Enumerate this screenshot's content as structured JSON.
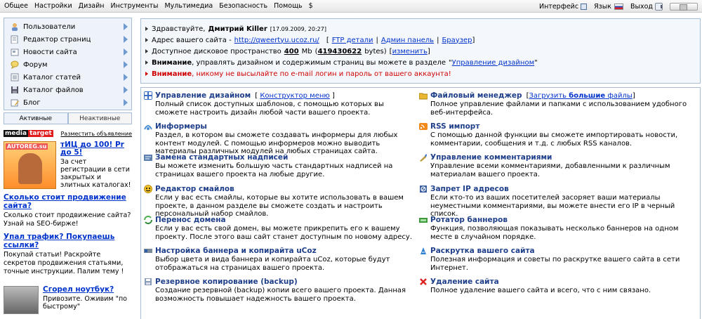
{
  "topbar": {
    "menu": [
      "Общее",
      "Настройки",
      "Дизайн",
      "Инструменты",
      "Мультимедиа",
      "Безопасность",
      "Помощь",
      "$"
    ],
    "interface_label": "Интерфейс",
    "lang_label": "Язык",
    "logout_label": "Выход"
  },
  "sidebar": {
    "items": [
      {
        "label": "Пользователи",
        "icon": "user-icon"
      },
      {
        "label": "Редактор страниц",
        "icon": "page-edit-icon"
      },
      {
        "label": "Новости сайта",
        "icon": "news-icon"
      },
      {
        "label": "Форум",
        "icon": "forum-icon"
      },
      {
        "label": "Каталог статей",
        "icon": "articles-icon"
      },
      {
        "label": "Каталог файлов",
        "icon": "files-icon"
      },
      {
        "label": "Блог",
        "icon": "blog-icon"
      }
    ],
    "tabs": {
      "active": "Активные",
      "inactive": "Неактивные"
    }
  },
  "ads": {
    "logo_media": "media",
    "logo_target": "target",
    "record_link": "Разместить объявление",
    "ad1": {
      "brand": "AUTOREG.su",
      "title": "тИЦ до 100! Pr до 5!",
      "text": "За счет регистрации в сети закрытых и элитных каталогах!"
    },
    "ad2": {
      "title": "Сколько стоит продвижение сайта?",
      "text": "Сколько стоит продвижение сайта? Узнай на SEO-бирже!"
    },
    "ad3": {
      "title": "Упал трафик? Покупаешь ссылки?",
      "text": "Покупай статьи! Раскройте секретов продвижения статьями, точные инструкции. Палим тему !"
    },
    "ad4": {
      "title": "Сгорел ноутбук?",
      "text": "Привозите. Оживим \"по быстрому\""
    }
  },
  "info": {
    "greeting_prefix": "Здравствуйте,",
    "username": "Дмитрий Killer",
    "timestamp": "[17.09.2009, 20:27]",
    "address_label": "Адрес вашего сайта -",
    "site_url": "http://qweertyu.ucoz.ru/",
    "ftp": "FTP детали",
    "admin": "Админ панель",
    "browser": "Браузер",
    "disk_label": "Доступное дисковое пространство",
    "disk_mb": "400",
    "disk_unit": "Mb",
    "disk_bytes": "419430622",
    "disk_bytes_unit": "bytes",
    "change": "изменить",
    "warn1_bold": "Внимание",
    "warn1_text": ", управлять дизайном и содержимым страниц вы можете в разделе",
    "warn1_link": "Управление дизайном",
    "warn2_bold": "Внимание",
    "warn2_text": ", никому не высылайте по e-mail логин и пароль от вашего аккаунта!"
  },
  "modules": {
    "left": [
      {
        "title": "Управление дизайном",
        "extra": "Конструктор меню",
        "desc": "Полный список доступных шаблонов, с помощью которых вы сможете настроить дизайн любой части вашего проекта.",
        "icon": "design-icon",
        "color": "#3a6fc4"
      },
      {
        "title": "Информеры",
        "desc": "Раздел, в котором вы сможете создавать информеры для любых контент модулей. С помощью информеров можно выводить материалы различных модулей на любых страницах сайта.",
        "icon": "informer-icon",
        "color": "#4a8fd6"
      },
      {
        "title": "Замена стандартных надписей",
        "desc": "Вы можете изменить большую часть стандартных надписей на страницах вашего проекта на любые другие.",
        "icon": "replace-icon",
        "color": "#5a7fb0"
      },
      {
        "title": "Редактор смайлов",
        "desc": "Если у вас есть смайлы, которые вы хотите использовать в вашем проекте, в данном разделе вы сможете создать и настроить персональный набор смайлов.",
        "icon": "smile-icon",
        "color": "#f2c22a"
      },
      {
        "title": "Перенос домена",
        "desc": "Если у вас есть свой домен, вы можете прикрепить его к вашему проекту. После этого ваш сайт станет доступным по новому адресу.",
        "icon": "domain-icon",
        "color": "#4caf50"
      },
      {
        "title": "Настройка баннера и копирайта uCoz",
        "desc": "Выбор цвета и вида баннера и копирайта uCoz, которые будут отображаться на страницах вашего проекта.",
        "icon": "banner-icon",
        "color": "#7a8a9a"
      },
      {
        "title": "Резервное копирование (backup)",
        "desc": "Создание резервной (backup) копии всего вашего проекта. Данная возможность повышает надежность вашего проекта.",
        "icon": "backup-icon",
        "color": "#8a9db8"
      }
    ],
    "right": [
      {
        "title": "Файловый менеджер",
        "extra_prefix": "Загрузить",
        "extra_bold": "большие",
        "extra_suffix": "файлы",
        "desc": "Полное управление файлами и папками с использованием удобного веб-интерфейса.",
        "icon": "folder-icon",
        "color": "#e8b830"
      },
      {
        "title": "RSS импорт",
        "desc": "С помощью данной функции вы сможете импортировать новости, комментарии, сообщения и т.д. с любых RSS каналов.",
        "icon": "rss-icon",
        "color": "#f08a1c"
      },
      {
        "title": "Управление комментариями",
        "desc": "Управление всеми комментариями, добавленными к различным материалам вашего проекта.",
        "icon": "comments-icon",
        "color": "#c09a40"
      },
      {
        "title": "Запрет IP адресов",
        "desc": "Если кто-то из ваших посетителей засоряет ваши материалы неуместными комментариями, вы можете внести его IP в черный список.",
        "icon": "ip-ban-icon",
        "color": "#3a5fa0"
      },
      {
        "title": "Ротатор баннеров",
        "desc": "Функция, позволяющая показывать несколько баннеров на одном месте в случайном порядке.",
        "icon": "rotator-icon",
        "color": "#3c9a3c"
      },
      {
        "title": "Раскрутка вашего сайта",
        "desc": "Полезная информация и советы по раскрутке вашего сайта в сети Интернет.",
        "icon": "promo-icon",
        "color": "#2f7fcf"
      },
      {
        "title": "Удаление сайта",
        "desc": "Полное удаление вашего сайта и всего, что с ним связано.",
        "icon": "delete-icon",
        "color": "#d22"
      }
    ]
  }
}
